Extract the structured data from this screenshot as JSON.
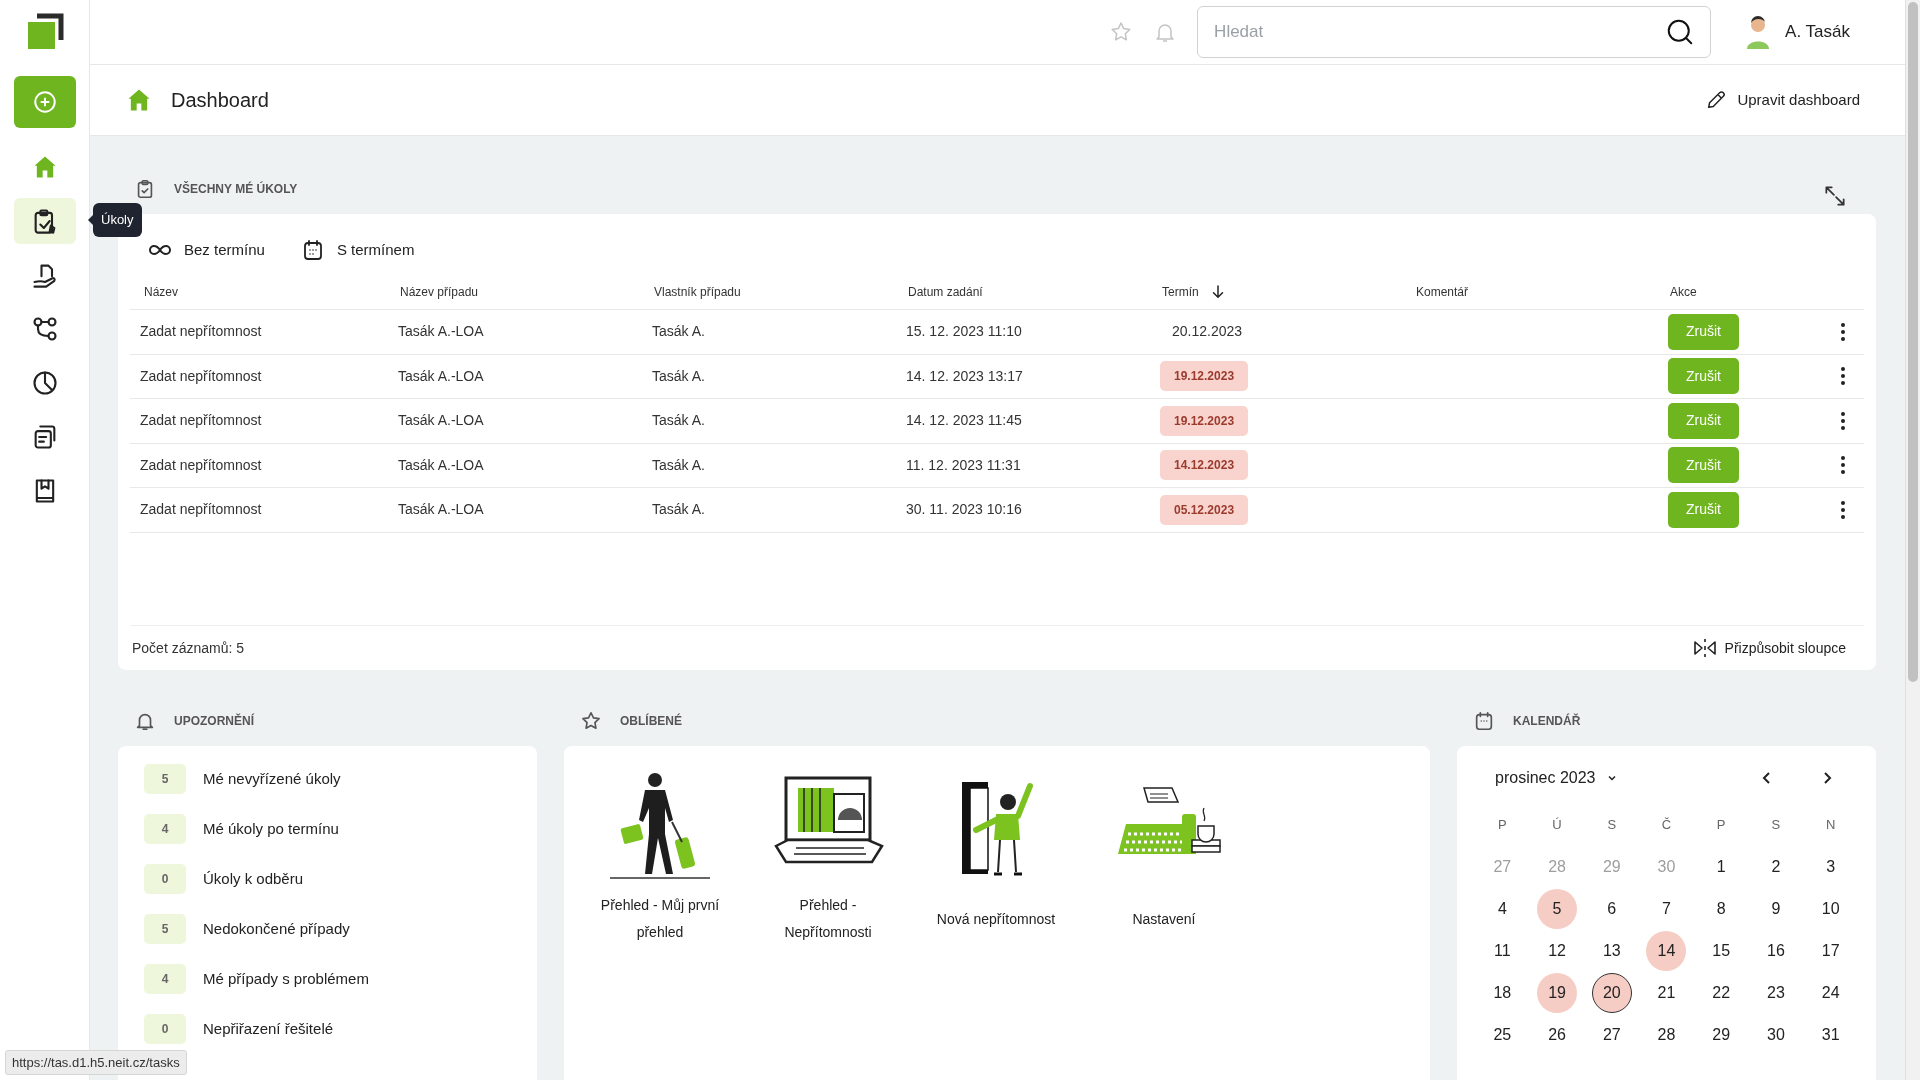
{
  "sidebar": {
    "items": [
      {
        "selected": false
      },
      {
        "selected": true
      },
      {
        "selected": false
      },
      {
        "selected": false
      },
      {
        "selected": false
      },
      {
        "selected": false
      },
      {
        "selected": false
      }
    ],
    "tooltip": "Úkoly"
  },
  "topbar": {
    "search": {
      "placeholder": "Hledat"
    },
    "user": "A. Tasák"
  },
  "header": {
    "title": "Dashboard",
    "edit_button": "Upravit dashboard"
  },
  "tasks": {
    "title": "VŠECHNY MÉ ÚKOLY",
    "tabs": [
      {
        "label": "Bez termínu"
      },
      {
        "label": "S termínem"
      }
    ],
    "columns": [
      {
        "label": "Název"
      },
      {
        "label": "Název případu"
      },
      {
        "label": "Vlastník případu"
      },
      {
        "label": "Datum zadání"
      },
      {
        "label": "Termín",
        "sort_descending": true
      },
      {
        "label": "Komentář"
      },
      {
        "label": "Akce"
      }
    ],
    "rows": [
      {
        "name": "Zadat nepřítomnost",
        "case": "Tasák A.-LOA",
        "owner": "Tasák A.",
        "assigned": "15. 12. 2023 11:10",
        "deadline": "20.12.2023",
        "overdue": false,
        "action": "Zrušit"
      },
      {
        "name": "Zadat nepřítomnost",
        "case": "Tasák A.-LOA",
        "owner": "Tasák A.",
        "assigned": "14. 12. 2023 13:17",
        "deadline": "19.12.2023",
        "overdue": true,
        "action": "Zrušit"
      },
      {
        "name": "Zadat nepřítomnost",
        "case": "Tasák A.-LOA",
        "owner": "Tasák A.",
        "assigned": "14. 12. 2023 11:45",
        "deadline": "19.12.2023",
        "overdue": true,
        "action": "Zrušit"
      },
      {
        "name": "Zadat nepřítomnost",
        "case": "Tasák A.-LOA",
        "owner": "Tasák A.",
        "assigned": "11. 12. 2023 11:31",
        "deadline": "14.12.2023",
        "overdue": true,
        "action": "Zrušit"
      },
      {
        "name": "Zadat nepřítomnost",
        "case": "Tasák A.-LOA",
        "owner": "Tasák A.",
        "assigned": "30. 11. 2023 10:16",
        "deadline": "05.12.2023",
        "overdue": true,
        "action": "Zrušit"
      }
    ],
    "record_count": "Počet záznamů: 5",
    "customize_button": "Přizpůsobit sloupce"
  },
  "notifications": {
    "title": "UPOZORNĚNÍ",
    "items": [
      {
        "count": "5",
        "label": "Mé nevyřízené úkoly"
      },
      {
        "count": "4",
        "label": "Mé úkoly po termínu"
      },
      {
        "count": "0",
        "label": "Úkoly k odběru"
      },
      {
        "count": "5",
        "label": "Nedokončené případy"
      },
      {
        "count": "4",
        "label": "Mé případy s problémem"
      },
      {
        "count": "0",
        "label": "Nepřiřazení řešitelé"
      }
    ]
  },
  "favorites": {
    "title": "OBLÍBENÉ",
    "items": [
      {
        "label": "Přehled - Můj první přehled"
      },
      {
        "label": "Přehled - Nepřítomnosti"
      },
      {
        "label": "Nová nepřítomnost"
      },
      {
        "label": "Nastavení"
      }
    ]
  },
  "calendar": {
    "title": "KALENDÁŘ",
    "month": "prosinec 2023",
    "weekdays": [
      "P",
      "Ú",
      "S",
      "Č",
      "P",
      "S",
      "N"
    ],
    "days": [
      {
        "label": "27",
        "outside": true,
        "marked": false,
        "today": false
      },
      {
        "label": "28",
        "outside": true,
        "marked": false,
        "today": false
      },
      {
        "label": "29",
        "outside": true,
        "marked": false,
        "today": false
      },
      {
        "label": "30",
        "outside": true,
        "marked": false,
        "today": false
      },
      {
        "label": "1",
        "outside": false,
        "marked": false,
        "today": false
      },
      {
        "label": "2",
        "outside": false,
        "marked": false,
        "today": false
      },
      {
        "label": "3",
        "outside": false,
        "marked": false,
        "today": false
      },
      {
        "label": "4",
        "outside": false,
        "marked": false,
        "today": false
      },
      {
        "label": "5",
        "outside": false,
        "marked": true,
        "today": false
      },
      {
        "label": "6",
        "outside": false,
        "marked": false,
        "today": false
      },
      {
        "label": "7",
        "outside": false,
        "marked": false,
        "today": false
      },
      {
        "label": "8",
        "outside": false,
        "marked": false,
        "today": false
      },
      {
        "label": "9",
        "outside": false,
        "marked": false,
        "today": false
      },
      {
        "label": "10",
        "outside": false,
        "marked": false,
        "today": false
      },
      {
        "label": "11",
        "outside": false,
        "marked": false,
        "today": false
      },
      {
        "label": "12",
        "outside": false,
        "marked": false,
        "today": false
      },
      {
        "label": "13",
        "outside": false,
        "marked": false,
        "today": false
      },
      {
        "label": "14",
        "outside": false,
        "marked": true,
        "today": false
      },
      {
        "label": "15",
        "outside": false,
        "marked": false,
        "today": false
      },
      {
        "label": "16",
        "outside": false,
        "marked": false,
        "today": false
      },
      {
        "label": "17",
        "outside": false,
        "marked": false,
        "today": false
      },
      {
        "label": "18",
        "outside": false,
        "marked": false,
        "today": false
      },
      {
        "label": "19",
        "outside": false,
        "marked": true,
        "today": false
      },
      {
        "label": "20",
        "outside": false,
        "marked": true,
        "today": true
      },
      {
        "label": "21",
        "outside": false,
        "marked": false,
        "today": false
      },
      {
        "label": "22",
        "outside": false,
        "marked": false,
        "today": false
      },
      {
        "label": "23",
        "outside": false,
        "marked": false,
        "today": false
      },
      {
        "label": "24",
        "outside": false,
        "marked": false,
        "today": false
      },
      {
        "label": "25",
        "outside": false,
        "marked": false,
        "today": false
      },
      {
        "label": "26",
        "outside": false,
        "marked": false,
        "today": false
      },
      {
        "label": "27",
        "outside": false,
        "marked": false,
        "today": false
      },
      {
        "label": "28",
        "outside": false,
        "marked": false,
        "today": false
      },
      {
        "label": "29",
        "outside": false,
        "marked": false,
        "today": false
      },
      {
        "label": "30",
        "outside": false,
        "marked": false,
        "today": false
      },
      {
        "label": "31",
        "outside": false,
        "marked": false,
        "today": false
      }
    ]
  },
  "status_url": "https://tas.d1.h5.neit.cz/tasks"
}
